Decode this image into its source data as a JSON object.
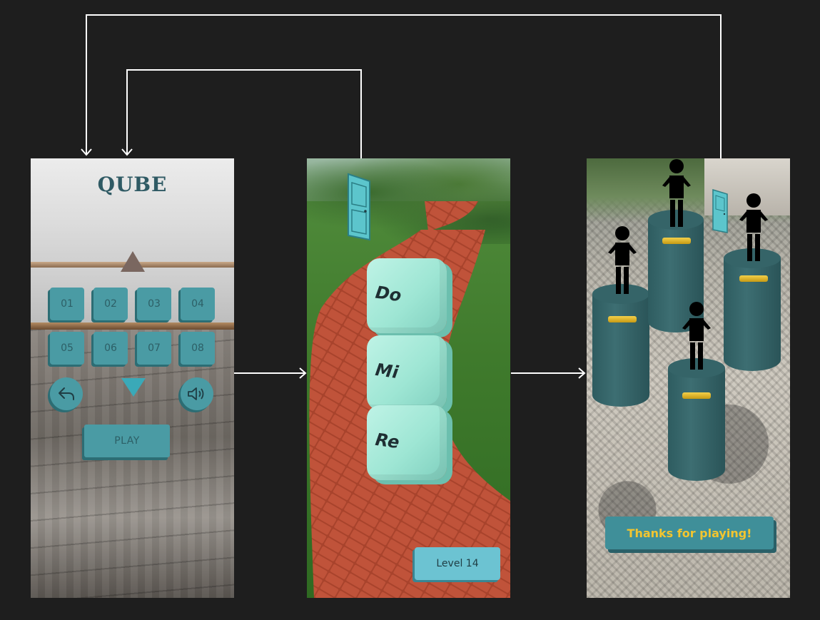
{
  "screens": {
    "menu": {
      "title": "QUBE",
      "levels": [
        "01",
        "02",
        "03",
        "04",
        "05",
        "06",
        "07",
        "08"
      ],
      "play_label": "PLAY"
    },
    "game": {
      "cubes": [
        "Do",
        "Mi",
        "Re"
      ],
      "level_label": "Level 14"
    },
    "end": {
      "thanks_label": "Thanks for playing!"
    }
  },
  "icons": {
    "back": "undo-arrow-icon",
    "sound": "speaker-icon",
    "nav_up": "triangle-up-icon",
    "nav_down": "triangle-down-icon",
    "door": "door-icon",
    "figure": "person-icon"
  },
  "colors": {
    "canvas": "#1e1e1e",
    "button": "#4a9ba4",
    "button_text": "#2d5f66",
    "cube": "#a8ebdb",
    "thanks_text": "#f2c530"
  }
}
